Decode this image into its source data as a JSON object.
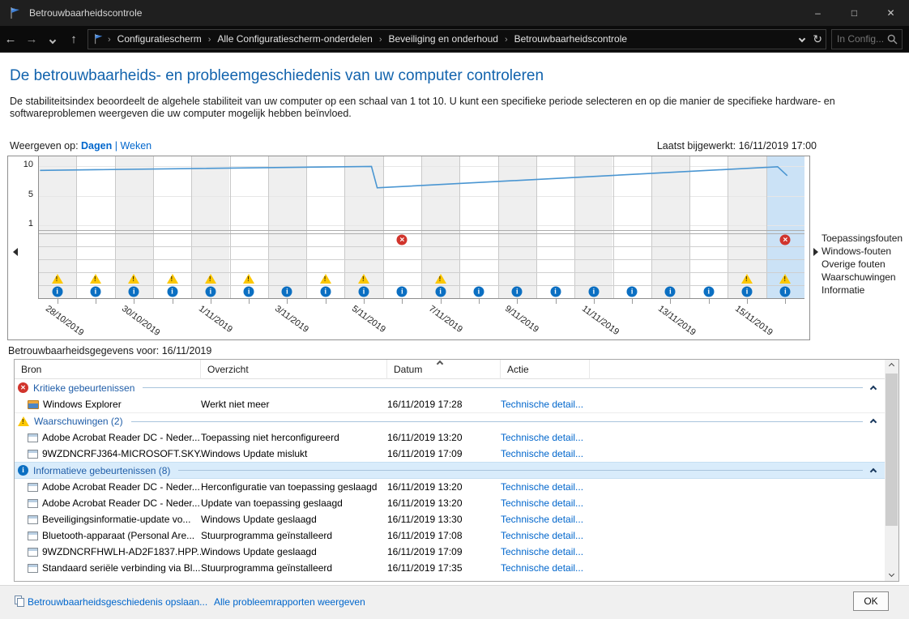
{
  "window": {
    "title": "Betrouwbaarheidscontrole",
    "controls": {
      "minimize": "–",
      "maximize": "□",
      "close": "✕"
    }
  },
  "nav": {
    "icons": {
      "back": "←",
      "forward": "→",
      "up": "↑",
      "refresh": "↻"
    },
    "breadcrumb_separator": "›",
    "breadcrumbs": [
      "Configuratiescherm",
      "Alle Configuratiescherm-onderdelen",
      "Beveiliging en onderhoud",
      "Betrouwbaarheidscontrole"
    ],
    "search_placeholder": "In Config..."
  },
  "header": {
    "title": "De betrouwbaarheids- en probleemgeschiedenis van uw computer controleren",
    "description": "De stabiliteitsindex beoordeelt de algehele stabiliteit van uw computer op een schaal van 1 tot 10. U kunt een specifieke periode selecteren en op die manier de specifieke hardware- en softwareproblemen weergeven die uw computer mogelijk hebben beïnvloed.",
    "view_label": "Weergeven op:",
    "view_options": [
      {
        "label": "Dagen",
        "active": true
      },
      {
        "label": "Weken",
        "active": false
      }
    ],
    "view_separator": "|",
    "last_updated": "Laatst bijgewerkt: 16/11/2019 17:00"
  },
  "chart_data": {
    "type": "line",
    "title": "Stabiliteitsindex per dag",
    "ylabels": [
      "10",
      "5",
      "1"
    ],
    "y_range": [
      1,
      10
    ],
    "days_shown": 20,
    "first_day": "28/10/2019",
    "selected_day_index": 20,
    "selected_date": "16/11/2019",
    "x_tick_labels": [
      "28/10/2019",
      "30/10/2019",
      "1/11/2019",
      "3/11/2019",
      "5/11/2019",
      "7/11/2019",
      "9/11/2019",
      "11/11/2019",
      "13/11/2019",
      "15/11/2019"
    ],
    "stability_line_points": [
      [
        0.05,
        9.35
      ],
      [
        8.7,
        9.95
      ],
      [
        8.85,
        6.7
      ],
      [
        19.3,
        9.9
      ],
      [
        19.55,
        8.55
      ]
    ],
    "event_rows": [
      {
        "label": "Toepassingsfouten",
        "icon": "error",
        "days": [
          10,
          20
        ]
      },
      {
        "label": "Windows-fouten",
        "icon": "error",
        "days": []
      },
      {
        "label": "Overige fouten",
        "icon": "error",
        "days": []
      },
      {
        "label": "Waarschuwingen",
        "icon": "warning",
        "days": [
          1,
          2,
          3,
          4,
          5,
          6,
          8,
          9,
          11,
          19,
          20
        ]
      },
      {
        "label": "Informatie",
        "icon": "info",
        "days": [
          1,
          2,
          3,
          4,
          5,
          6,
          7,
          8,
          9,
          10,
          11,
          12,
          13,
          14,
          15,
          16,
          17,
          18,
          19,
          20
        ]
      }
    ],
    "colors": {
      "line": "#4a96d2",
      "selected_column": "#cbe2f6",
      "band": "#efefef",
      "error": "#d1342c",
      "warning": "#fdc804",
      "info": "#0b6fc2"
    }
  },
  "icons": {
    "error_glyph": "✕",
    "warning_glyph": "!",
    "info_glyph": "i"
  },
  "details": {
    "title": "Betrouwbaarheidsgegevens voor: 16/11/2019",
    "columns": [
      "Bron",
      "Overzicht",
      "Datum",
      "Actie"
    ],
    "sort_column": "Datum",
    "rows": [
      {
        "kind": "group",
        "icon": "error",
        "label": "Kritieke gebeurtenissen",
        "highlighted": false
      },
      {
        "kind": "item",
        "icon": "folder",
        "source": "Windows Explorer",
        "overview": "Werkt niet meer",
        "date": "16/11/2019 17:28",
        "action": "Technische detail..."
      },
      {
        "kind": "group",
        "icon": "warning",
        "label": "Waarschuwingen (2)",
        "highlighted": false
      },
      {
        "kind": "item",
        "icon": "app",
        "source": "Adobe Acrobat Reader DC - Neder...",
        "overview": "Toepassing niet herconfigureerd",
        "date": "16/11/2019 13:20",
        "action": "Technische detail..."
      },
      {
        "kind": "item",
        "icon": "app",
        "source": "9WZDNCRFJ364-MICROSOFT.SKY...",
        "overview": "Windows Update mislukt",
        "date": "16/11/2019 17:09",
        "action": "Technische detail..."
      },
      {
        "kind": "group",
        "icon": "info",
        "label": "Informatieve gebeurtenissen (8)",
        "highlighted": true
      },
      {
        "kind": "item",
        "icon": "app",
        "source": "Adobe Acrobat Reader DC - Neder...",
        "overview": "Herconfiguratie van toepassing geslaagd",
        "date": "16/11/2019 13:20",
        "action": "Technische detail..."
      },
      {
        "kind": "item",
        "icon": "app",
        "source": "Adobe Acrobat Reader DC - Neder...",
        "overview": "Update van toepassing geslaagd",
        "date": "16/11/2019 13:20",
        "action": "Technische detail..."
      },
      {
        "kind": "item",
        "icon": "app",
        "source": "Beveiligingsinformatie-update vo...",
        "overview": "Windows Update geslaagd",
        "date": "16/11/2019 13:30",
        "action": "Technische detail..."
      },
      {
        "kind": "item",
        "icon": "app",
        "source": "Bluetooth-apparaat (Personal Are...",
        "overview": "Stuurprogramma geïnstalleerd",
        "date": "16/11/2019 17:08",
        "action": "Technische detail..."
      },
      {
        "kind": "item",
        "icon": "app",
        "source": "9WZDNCRFHWLH-AD2F1837.HPP...",
        "overview": "Windows Update geslaagd",
        "date": "16/11/2019 17:09",
        "action": "Technische detail..."
      },
      {
        "kind": "item",
        "icon": "app",
        "source": "Standaard seriële verbinding via Bl...",
        "overview": "Stuurprogramma geïnstalleerd",
        "date": "16/11/2019 17:35",
        "action": "Technische detail..."
      }
    ]
  },
  "footer": {
    "save_link": "Betrouwbaarheidsgeschiedenis opslaan...",
    "reports_link": "Alle probleemrapporten weergeven",
    "ok_label": "OK"
  }
}
